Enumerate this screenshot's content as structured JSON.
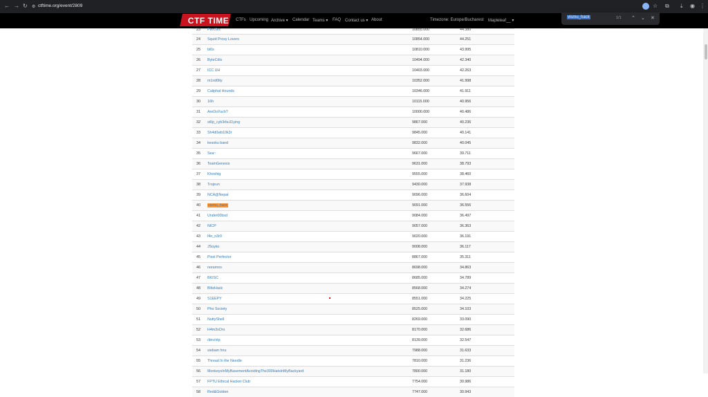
{
  "browser": {
    "url": "ctftime.org/event/2809",
    "back_icon": "arrow-left-icon",
    "forward_icon": "arrow-right-icon",
    "reload_icon": "reload-icon"
  },
  "site": {
    "logo_text": "CTF TIME",
    "nav": [
      "CTFs",
      "Upcoming",
      "Archive ▾",
      "Calendar",
      "Teams ▾",
      "FAQ",
      "Contact us ▾",
      "About"
    ],
    "timezone": "Timezone: Europe/Bucharest",
    "user": "Mapleleaf__ ▾"
  },
  "find": {
    "query": "vismu_hack",
    "count": "1/1"
  },
  "rows": [
    {
      "rank": "23",
      "team": "PwnSec",
      "points": "10855.000",
      "rating": "44.380"
    },
    {
      "rank": "24",
      "team": "Squid Proxy Lovers",
      "points": "10854.000",
      "rating": "44.251"
    },
    {
      "rank": "25",
      "team": "bi0s",
      "points": "10810.000",
      "rating": "43.995"
    },
    {
      "rank": "26",
      "team": "ByteCdls",
      "points": "10494.000",
      "rating": "42.340"
    },
    {
      "rank": "27",
      "team": "ICC UH",
      "points": "10403.000",
      "rating": "42.263"
    },
    {
      "rank": "28",
      "team": "m1nd0lty",
      "points": "10352.000",
      "rating": "41.998"
    },
    {
      "rank": "29",
      "team": "Caliphal Hounds",
      "points": "10346.000",
      "rating": "41.911"
    },
    {
      "rank": "30",
      "team": "16h",
      "points": "10115.000",
      "rating": "40.956"
    },
    {
      "rank": "31",
      "team": "AreDoYuch?",
      "points": "10000.000",
      "rating": "40.486"
    },
    {
      "rank": "32",
      "team": "st0p_cyb3rbu11ying",
      "points": "9867.000",
      "rating": "40.236"
    },
    {
      "rank": "33",
      "team": "Sh4d0wb10k3r",
      "points": "9845.000",
      "rating": "40.141"
    },
    {
      "rank": "34",
      "team": "kesoku band",
      "points": "9832.000",
      "rating": "40.045"
    },
    {
      "rank": "35",
      "team": "Sea~",
      "points": "9667.000",
      "rating": "39.711"
    },
    {
      "rank": "36",
      "team": "TeamGenesis",
      "points": "9631.000",
      "rating": "38.793"
    },
    {
      "rank": "37",
      "team": "Khoshig",
      "points": "9555.000",
      "rating": "38.460"
    },
    {
      "rank": "38",
      "team": "Trojeun",
      "points": "9430.000",
      "rating": "37.938"
    },
    {
      "rank": "39",
      "team": "NCA@Nepal",
      "points": "9096.000",
      "rating": "36.604"
    },
    {
      "rank": "40",
      "team": "vismu_hack",
      "points": "9091.000",
      "rating": "36.556",
      "highlight": true
    },
    {
      "rank": "41",
      "team": "Under00bsd",
      "points": "9084.000",
      "rating": "36.497"
    },
    {
      "rank": "42",
      "team": "NICP",
      "points": "9057.000",
      "rating": "36.363"
    },
    {
      "rank": "43",
      "team": "f4n_n3r0",
      "points": "9020.000",
      "rating": "36.191"
    },
    {
      "rank": "44",
      "team": "JSoyko",
      "points": "9008.000",
      "rating": "36.117"
    },
    {
      "rank": "45",
      "team": "Pixel Perfector",
      "points": "8867.000",
      "rating": "35.311"
    },
    {
      "rank": "46",
      "team": "noramoo",
      "points": "8698.000",
      "rating": "34.863"
    },
    {
      "rank": "47",
      "team": "BKISC",
      "points": "8685.000",
      "rating": "34.789"
    },
    {
      "rank": "48",
      "team": "BlitzHack",
      "points": "8568.000",
      "rating": "34.274"
    },
    {
      "rank": "49",
      "team": "S1EEPY",
      "points": "8551.000",
      "rating": "34.225"
    },
    {
      "rank": "50",
      "team": "Pho Society",
      "points": "8525.000",
      "rating": "34.103"
    },
    {
      "rank": "51",
      "team": "NuttyShell",
      "points": "8269.000",
      "rating": "33.090"
    },
    {
      "rank": "52",
      "team": "H4m3sOrs",
      "points": "8170.000",
      "rating": "32.686"
    },
    {
      "rank": "53",
      "team": "/dev/stp",
      "points": "8139.000",
      "rating": "32.547"
    },
    {
      "rank": "54",
      "team": "siebam hnu",
      "points": "7988.000",
      "rating": "31.633"
    },
    {
      "rank": "55",
      "team": "Thread In the Needle",
      "points": "7810.000",
      "rating": "31.236"
    },
    {
      "rank": "56",
      "team": "MonkeysInMyBasementAvoidingThe300HatsInMyBackyard",
      "points": "7800.000",
      "rating": "31.180"
    },
    {
      "rank": "57",
      "team": "FPTU Ethical Hacker Club",
      "points": "7754.000",
      "rating": "30.986"
    },
    {
      "rank": "58",
      "team": "Red&Golden",
      "points": "7747.000",
      "rating": "30.943"
    }
  ]
}
